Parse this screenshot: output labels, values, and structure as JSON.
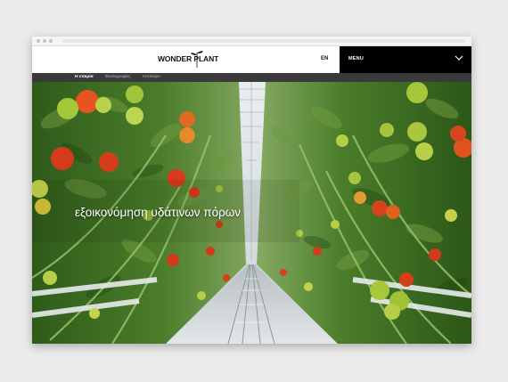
{
  "site": {
    "logo_text": "WONDER PLANT",
    "language": "EN",
    "menu_label": "MENU"
  },
  "subnav": {
    "items": [
      {
        "label": "Η εταιρία",
        "active": true
      },
      {
        "label": "Φωτογραφίες",
        "active": false
      },
      {
        "label": "Ιστολόγιο",
        "active": false
      }
    ]
  },
  "hero": {
    "tagline": "εξοικονόμηση υδάτινων πόρων",
    "image": "greenhouse-tomato-rows"
  },
  "icons": {
    "menu_toggle": "chevron-down-icon",
    "logo_mark": "plant-sprout-icon"
  },
  "colors": {
    "header_bg": "#ffffff",
    "menu_bg": "#000000",
    "subnav_bg": "#3a3a3a",
    "page_bg": "#ebebeb"
  }
}
